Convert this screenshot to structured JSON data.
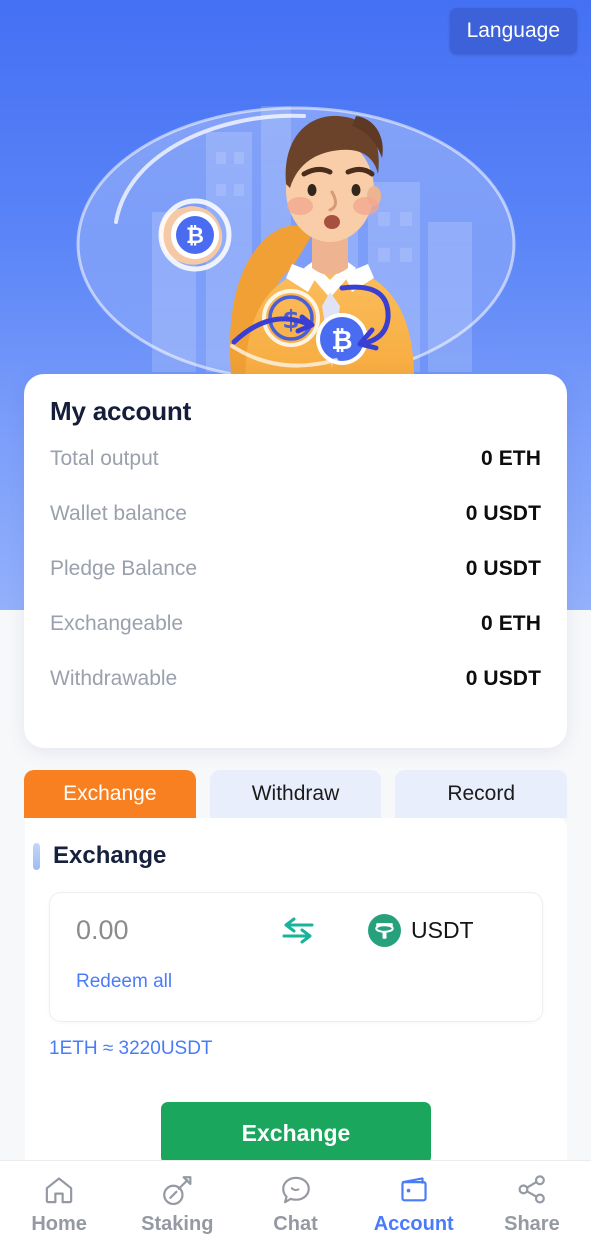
{
  "header": {
    "language_button": "Language"
  },
  "hero": {
    "illustration_name": "man-holding-bitcoin-illustration"
  },
  "account_card": {
    "title": "My account",
    "rows": [
      {
        "label": "Total output",
        "value": "0 ETH"
      },
      {
        "label": "Wallet balance",
        "value": "0 USDT"
      },
      {
        "label": "Pledge Balance",
        "value": "0 USDT"
      },
      {
        "label": "Exchangeable",
        "value": "0 ETH"
      },
      {
        "label": "Withdrawable",
        "value": "0 USDT"
      }
    ]
  },
  "tabs": [
    {
      "label": "Exchange",
      "active": true
    },
    {
      "label": "Withdraw",
      "active": false
    },
    {
      "label": "Record",
      "active": false
    }
  ],
  "exchange_panel": {
    "title": "Exchange",
    "amount_value": "",
    "amount_placeholder": "0.00",
    "swap_icon": "swap-arrows-icon",
    "coin_icon": "usdt-tether-icon",
    "coin_label": "USDT",
    "redeem_all_label": "Redeem all",
    "rate_text": "1ETH ≈ 3220USDT",
    "submit_label": "Exchange"
  },
  "bottom_nav": [
    {
      "label": "Home",
      "icon": "home-icon",
      "active": false
    },
    {
      "label": "Staking",
      "icon": "shovel-icon",
      "active": false
    },
    {
      "label": "Chat",
      "icon": "chat-bubble-icon",
      "active": false
    },
    {
      "label": "Account",
      "icon": "wallet-icon",
      "active": true
    },
    {
      "label": "Share",
      "icon": "share-nodes-icon",
      "active": false
    }
  ],
  "colors": {
    "hero_blue_top": "#4470f4",
    "hero_blue_bottom": "#93b0fb",
    "accent_orange": "#f98020",
    "accent_green": "#1aa75d",
    "link_blue": "#4a7cfa",
    "usdt_green": "#26a17b",
    "swap_teal": "#17b39a",
    "tab_inactive_bg": "#e8eefb"
  }
}
